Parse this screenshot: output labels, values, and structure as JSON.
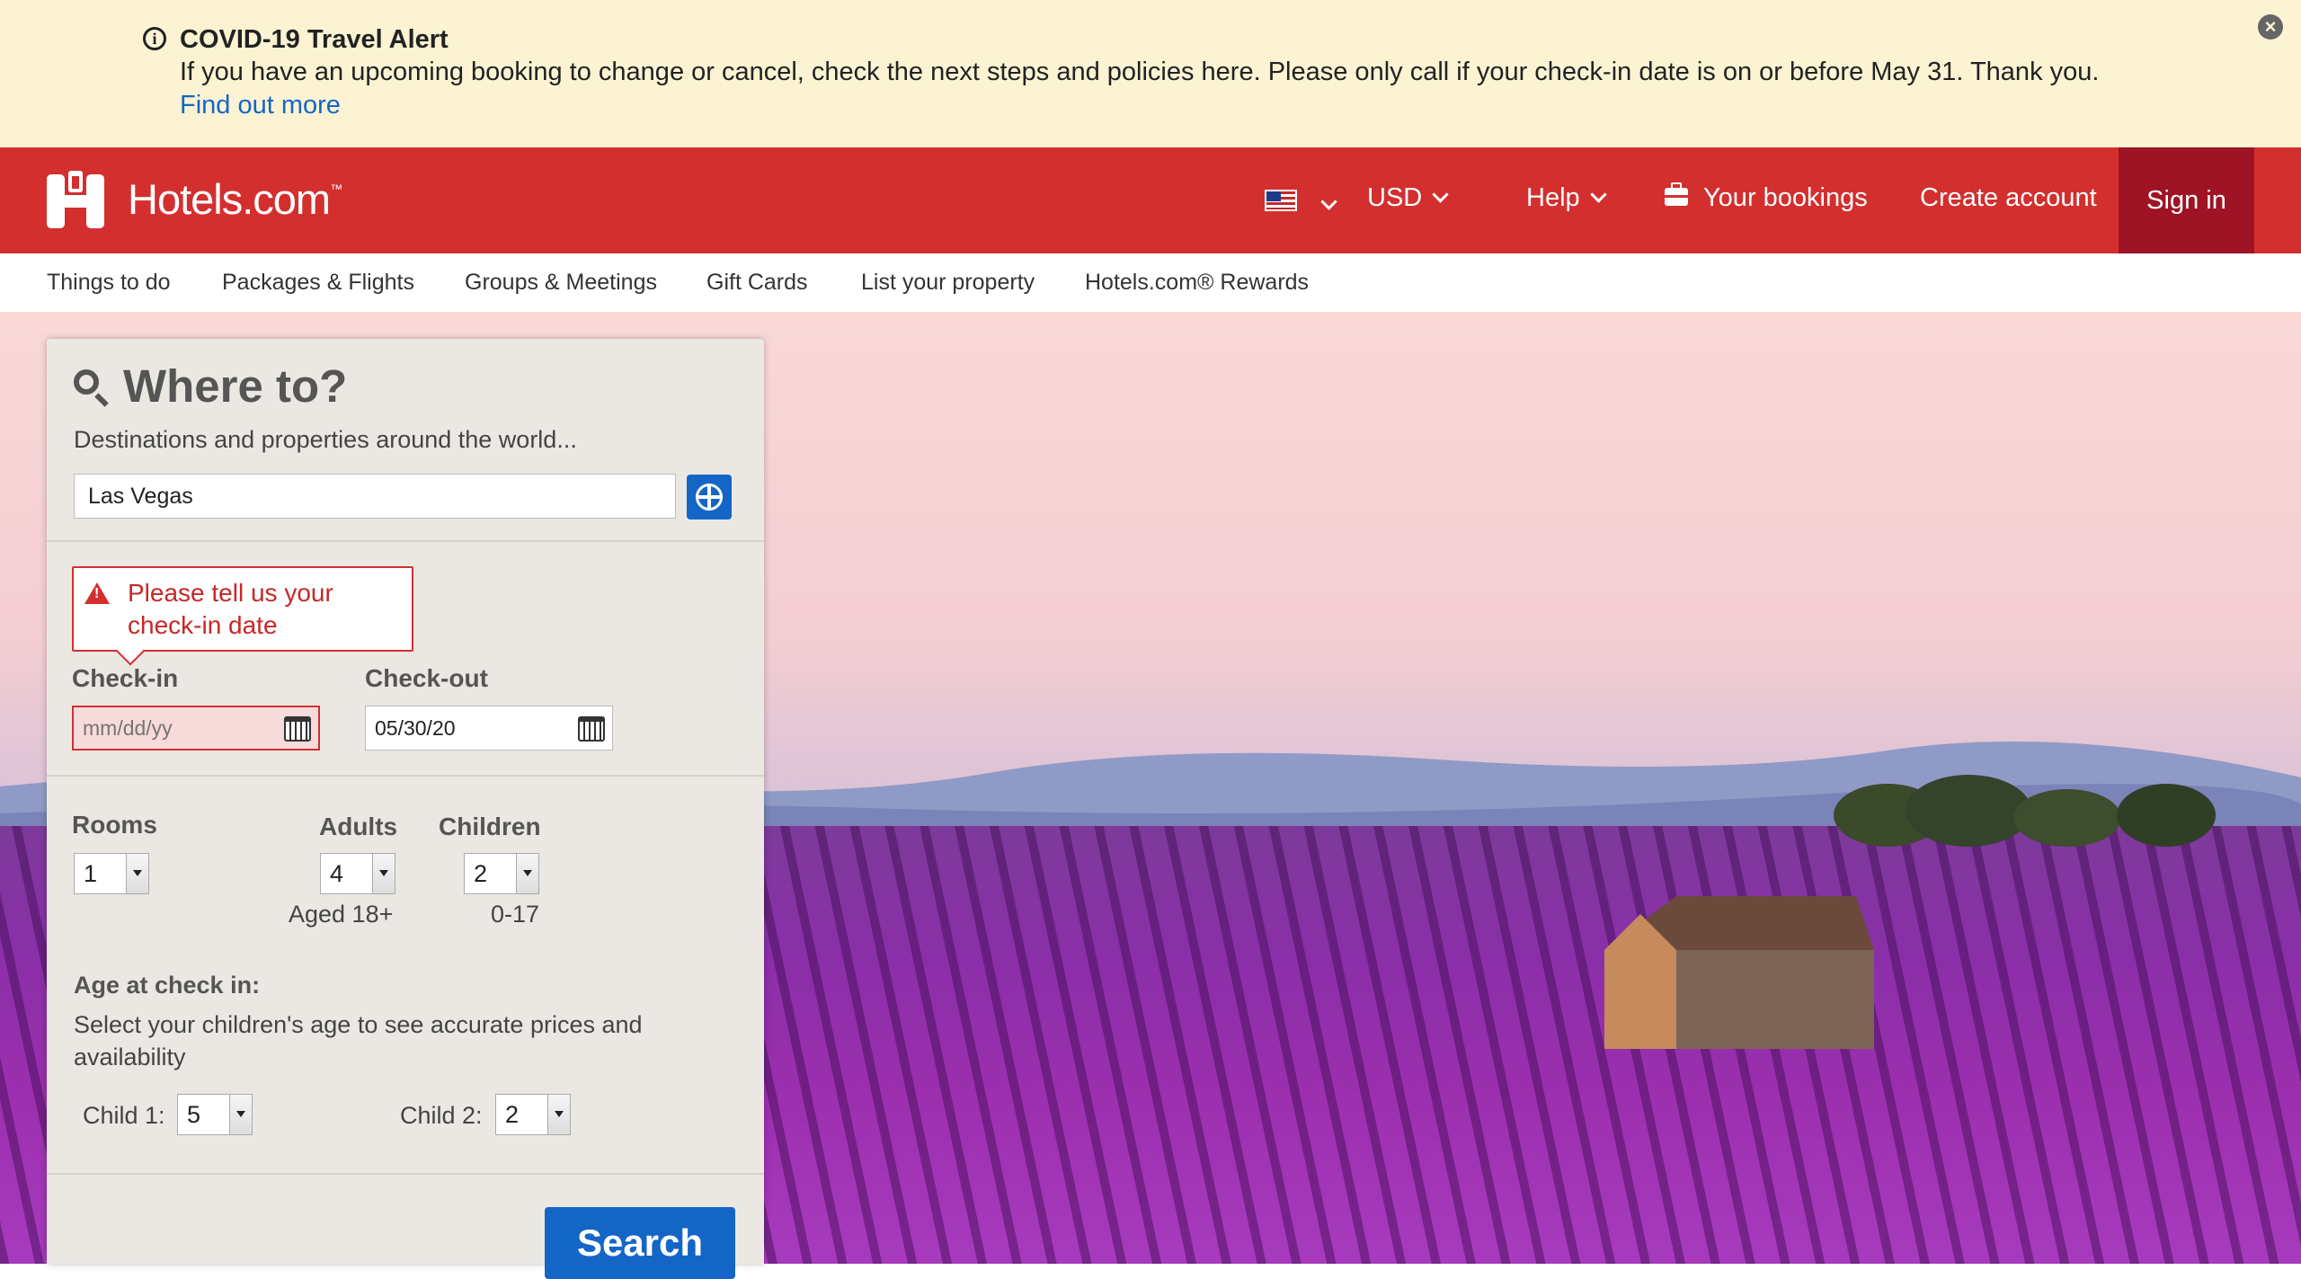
{
  "alert": {
    "title": "COVID-19 Travel Alert",
    "message": "If you have an upcoming booking to change or cancel, check the next steps and policies here. Please only call if your check-in date is on or before May 31. Thank you.",
    "link": "Find out more"
  },
  "header": {
    "brand": "Hotels.com",
    "brand_tm": "™",
    "currency": "USD",
    "help": "Help",
    "bookings": "Your bookings",
    "create_account": "Create account",
    "sign_in": "Sign in",
    "brand_color": "#d32f2f"
  },
  "subnav": [
    "Things to do",
    "Packages & Flights",
    "Groups & Meetings",
    "Gift Cards",
    "List your property",
    "Hotels.com® Rewards"
  ],
  "search": {
    "title": "Where to?",
    "subtitle": "Destinations and properties around the world...",
    "destination_value": "Las Vegas",
    "error": "Please tell us your check-in date",
    "checkin_label": "Check-in",
    "checkin_placeholder": "mm/dd/yy",
    "checkout_label": "Check-out",
    "checkout_value": "05/30/20",
    "rooms_label": "Rooms",
    "rooms_value": "1",
    "adults_label": "Adults",
    "adults_value": "4",
    "adults_note": "Aged 18+",
    "children_label": "Children",
    "children_value": "2",
    "children_note": "0-17",
    "age_title": "Age at check in:",
    "age_desc": "Select your children's age to see accurate prices and availability",
    "child1_label": "Child 1:",
    "child1_value": "5",
    "child2_label": "Child 2:",
    "child2_value": "2",
    "search_button": "Search",
    "accent_color": "#1466c6"
  }
}
